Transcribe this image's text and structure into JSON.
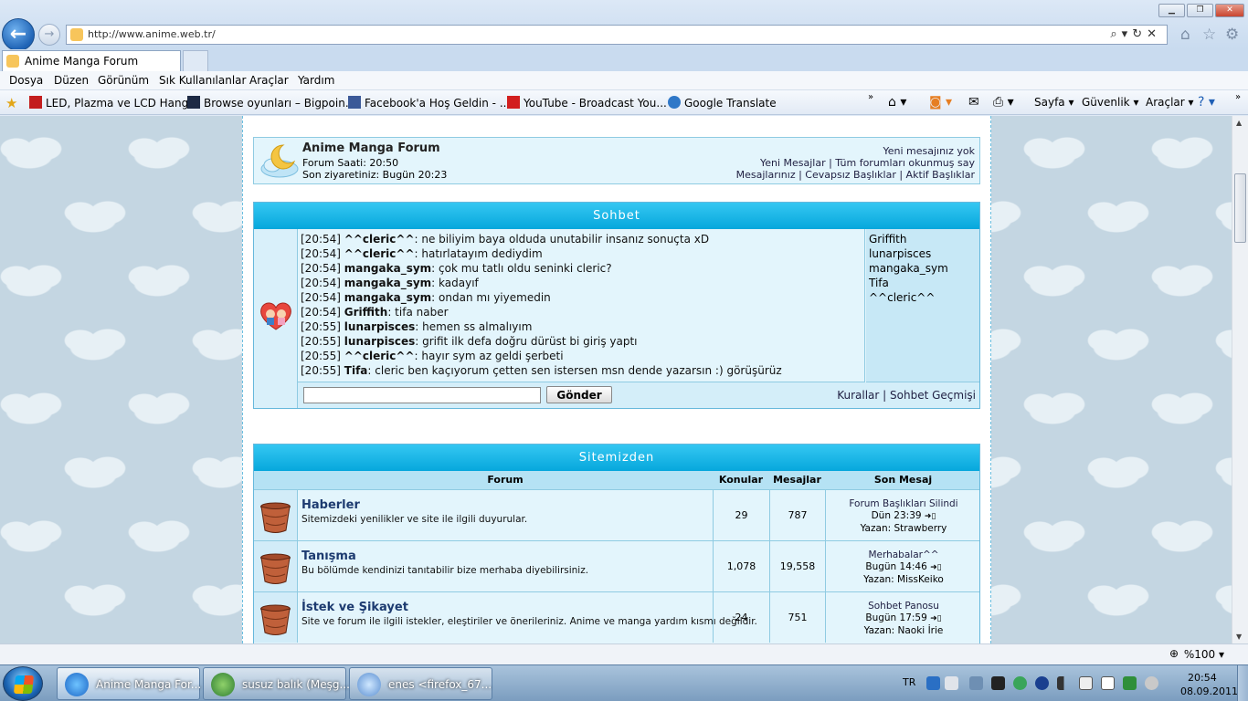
{
  "browser": {
    "url": "http://www.anime.web.tr/",
    "tab_title": "Anime Manga Forum",
    "menu": [
      "Dosya",
      "Düzen",
      "Görünüm",
      "Sık Kullanılanlar",
      "Araçlar",
      "Yardım"
    ],
    "favorites": [
      "LED, Plazma ve LCD Hang...",
      "Browse oyunları – Bigpoin...",
      "Facebook'a Hoş Geldin - ...",
      "YouTube - Broadcast You...",
      "Google Translate"
    ],
    "commands": [
      "Sayfa",
      "Güvenlik",
      "Araçlar"
    ],
    "zoom": "%100"
  },
  "header": {
    "forum_name": "Anime Manga Forum",
    "forum_time": "Forum Saati: 20:50",
    "last_visit": "Son ziyaretiniz: Bugün 20:23",
    "no_new_messages": "Yeni mesajınız yok",
    "links_line1": "Yeni Mesajlar | Tüm forumları okunmuş say",
    "links_line2": "Mesajlarınız | Cevapsız Başlıklar | Aktif Başlıklar"
  },
  "chat": {
    "title": "Sohbet",
    "messages": [
      {
        "time": "[20:54]",
        "user": "^^cleric^^",
        "text": ": ne biliyim baya olduda unutabilir insanız sonuçta xD"
      },
      {
        "time": "[20:54]",
        "user": "^^cleric^^",
        "text": ": hatırlatayım dediydim"
      },
      {
        "time": "[20:54]",
        "user": "mangaka_sym",
        "text": ": çok mu tatlı oldu seninki cleric?"
      },
      {
        "time": "[20:54]",
        "user": "mangaka_sym",
        "text": ": kadayıf"
      },
      {
        "time": "[20:54]",
        "user": "mangaka_sym",
        "text": ": ondan mı yiyemedin"
      },
      {
        "time": "[20:54]",
        "user": "Griffith",
        "text": ": tifa naber"
      },
      {
        "time": "[20:55]",
        "user": "lunarpisces",
        "text": ": hemen ss almalıyım"
      },
      {
        "time": "[20:55]",
        "user": "lunarpisces",
        "text": ": grifit ilk defa doğru dürüst bi giriş yaptı"
      },
      {
        "time": "[20:55]",
        "user": "^^cleric^^",
        "text": ": hayır sym az geldi şerbeti"
      },
      {
        "time": "[20:55]",
        "user": "Tifa",
        "text": ": cleric ben kaçıyorum çetten sen istersen msn dende yazarsın :) görüşürüz"
      }
    ],
    "users": [
      "Griffith",
      "lunarpisces",
      "mangaka_sym",
      "Tifa",
      "^^cleric^^"
    ],
    "input_value": "",
    "send_label": "Gönder",
    "rules_link": "Kurallar",
    "history_link": "Sohbet Geçmişi"
  },
  "forums": {
    "title": "Sitemizden",
    "columns": {
      "forum": "Forum",
      "topics": "Konular",
      "posts": "Mesajlar",
      "last_post": "Son Mesaj"
    },
    "rows": [
      {
        "name": "Haberler",
        "desc": "Sitemizdeki yenilikler ve site ile ilgili duyurular.",
        "topics": "29",
        "posts": "787",
        "last_topic": "Forum Başlıkları Silindi",
        "last_time": "Dün 23:39",
        "last_author": "Yazan:  Strawberry"
      },
      {
        "name": "Tanışma",
        "desc": "Bu bölümde kendinizi tanıtabilir bize merhaba diyebilirsiniz.",
        "topics": "1,078",
        "posts": "19,558",
        "last_topic": "Merhabalar^^",
        "last_time": "Bugün 14:46",
        "last_author": "Yazan:  MissKeiko"
      },
      {
        "name": "İstek ve Şikayet",
        "desc": "Site ve forum ile ilgili istekler, eleştiriler ve önerileriniz. Anime ve manga yardım kısmı değildir.",
        "topics": "24",
        "posts": "751",
        "last_topic": "Sohbet Panosu",
        "last_time": "Bugün 17:59",
        "last_author": "Yazan:  Naoki İrie"
      }
    ]
  },
  "taskbar": {
    "tasks": [
      "Anime Manga For...",
      "susuz balık (Meşg...",
      "enes <firefox_67..."
    ],
    "lang": "TR",
    "time": "20:54",
    "date": "08.09.2011"
  }
}
